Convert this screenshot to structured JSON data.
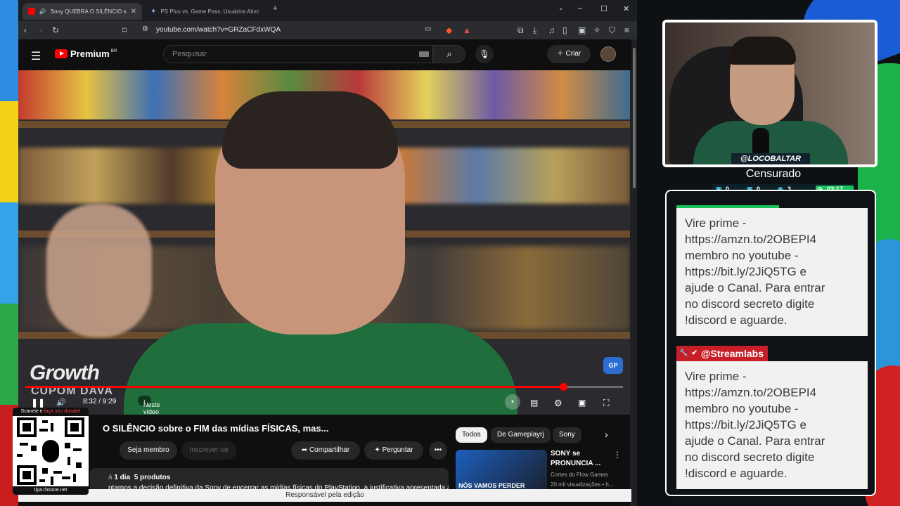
{
  "browser": {
    "tabs": [
      {
        "title": "Sony QUEBRA O SILÊNCIO sobre o",
        "active": true
      },
      {
        "title": "PS Plus vs. Game Pass: Usuários Ativos - Goo",
        "active": false
      }
    ],
    "url": "youtube.com/watch?v=GRZaCFdxWQA"
  },
  "youtube": {
    "logo_text": "Premium",
    "region": "BR",
    "search_placeholder": "Pesquisar",
    "create_label": "Criar",
    "video": {
      "time_current": "8:32",
      "time_total": "9:29",
      "time_text": "8:32 / 9:29",
      "next_label": "Neste vídeo",
      "progress": 0.9,
      "overlay_brand": "Growth",
      "overlay_sub": "CUPOM DAVA",
      "watermark": "GP"
    },
    "title": "O SILÊNCIO sobre o FIM das mídias FÍSICAS, mas...",
    "buttons": {
      "join": "Seja membro",
      "subscribe": "Inscrever-se",
      "share": "Compartilhar",
      "ask": "Perguntar"
    },
    "chips": [
      "Todos",
      "De Gameplayrj",
      "Sony"
    ],
    "description": {
      "meta_prefix": "á",
      "age": "1 dia",
      "products": "5 produtos",
      "snippet": "ntamos a decisão definitiva da Sony de encerrar as mídias físicas do PlayStation, a justificativa apresentada aos"
    },
    "recommended": {
      "thumb_text": "NÓS VAMOS PERDER",
      "title_line1": "SONY se",
      "title_line2": "PRONUNCIA ...",
      "channel": "Cortes do Flow Games",
      "views": "20 mil visualizações • h..."
    },
    "edit_bar": "Responsável pela edição"
  },
  "qr": {
    "header_prefix": "Scaneie e ",
    "header_highlight": "faça seu donate!",
    "footer": "tipa.rbstore.net"
  },
  "stream": {
    "handle": "@LOCOBALTAR",
    "status": "Censurado",
    "stats": {
      "a": "0",
      "b": "0",
      "c": "3",
      "timer": "03:17"
    }
  },
  "chat": {
    "messages": [
      {
        "author": "",
        "lines": [
          "Vire prime -",
          "https://amzn.to/2OBEPI4",
          "membro no youtube -",
          "https://bit.ly/2JiQ5TG e",
          "ajude o Canal. Para entrar",
          "no discord secreto digite",
          "!discord e aguarde."
        ]
      },
      {
        "author": "@Streamlabs",
        "lines": [
          "Vire prime -",
          "https://amzn.to/2OBEPI4",
          "membro no youtube -",
          "https://bit.ly/2JiQ5TG e",
          "ajude o Canal. Para entrar",
          "no discord secreto digite",
          "!discord e aguarde."
        ]
      }
    ]
  },
  "colors": {
    "accent_red": "#ff0000",
    "chat_bg": "#f1f1f1",
    "streamlabs_red": "#c81e28",
    "green": "#17c35a"
  }
}
